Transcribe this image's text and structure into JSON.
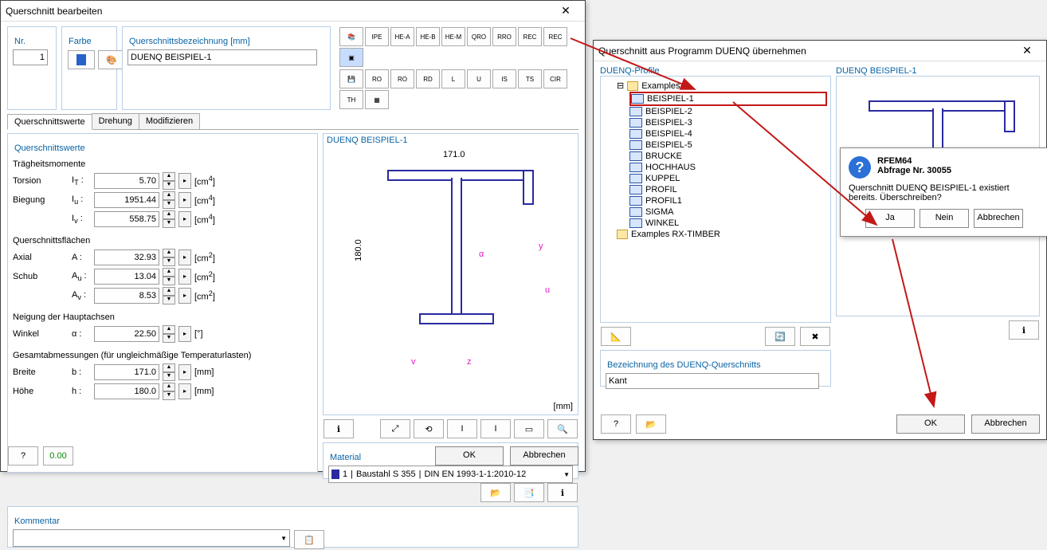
{
  "dlg1": {
    "title": "Querschnitt bearbeiten",
    "close": "✕",
    "nr": {
      "label": "Nr.",
      "value": "1"
    },
    "farbe": {
      "label": "Farbe"
    },
    "desig": {
      "label": "Querschnittsbezeichnung [mm]",
      "value": "DUENQ BEISPIEL-1"
    },
    "tabs": [
      "Querschnittswerte",
      "Drehung",
      "Modifizieren"
    ],
    "qsw": {
      "title": "Querschnittswerte",
      "traeg": "Trägheitsmomente",
      "rows1": [
        {
          "lab": "Torsion",
          "sym": "I<sub>T</sub> :",
          "val": "5.70",
          "unit": "[cm<sup>4</sup>]"
        },
        {
          "lab": "Biegung",
          "sym": "I<sub>u</sub> :",
          "val": "1951.44",
          "unit": "[cm<sup>4</sup>]"
        },
        {
          "lab": "",
          "sym": "I<sub>v</sub> :",
          "val": "558.75",
          "unit": "[cm<sup>4</sup>]"
        }
      ],
      "qf": "Querschnittsflächen",
      "rows2": [
        {
          "lab": "Axial",
          "sym": "A :",
          "val": "32.93",
          "unit": "[cm<sup>2</sup>]"
        },
        {
          "lab": "Schub",
          "sym": "A<sub>u</sub> :",
          "val": "13.04",
          "unit": "[cm<sup>2</sup>]"
        },
        {
          "lab": "",
          "sym": "A<sub>v</sub> :",
          "val": "8.53",
          "unit": "[cm<sup>2</sup>]"
        }
      ],
      "neig": "Neigung der Hauptachsen",
      "winkel": {
        "lab": "Winkel",
        "sym": "α :",
        "val": "22.50",
        "unit": "[°]"
      },
      "ges": "Gesamtabmessungen (für ungleichmäßige Temperaturlasten)",
      "breite": {
        "lab": "Breite",
        "sym": "b :",
        "val": "171.0",
        "unit": "[mm]"
      },
      "hoehe": {
        "lab": "Höhe",
        "sym": "h :",
        "val": "180.0",
        "unit": "[mm]"
      }
    },
    "kommentar": {
      "label": "Kommentar",
      "value": ""
    },
    "preview": {
      "title": "DUENQ BEISPIEL-1",
      "w": "171.0",
      "h": "180.0",
      "mm": "[mm]",
      "axes": {
        "y": "y",
        "u": "u",
        "z": "z",
        "v": "v",
        "a": "α"
      }
    },
    "material": {
      "label": "Material",
      "idx": "1",
      "name": "Baustahl S 355",
      "code": "DIN EN 1993-1-1:2010-12"
    },
    "ok": "OK",
    "cancel": "Abbrechen",
    "sectionButtons": [
      "IPE",
      "HE-A",
      "HE-B",
      "HE-M",
      "QRO",
      "RRO",
      "REC",
      "REC"
    ],
    "sectionButtons2": [
      "RO",
      "RO",
      "RD",
      "L",
      "U",
      "IS",
      "TS",
      "CIR",
      "TH"
    ]
  },
  "dlg2": {
    "title": "Querschnitt aus Programm DUENQ übernehmen",
    "close": "✕",
    "profLabel": "DUENQ-Profile",
    "tree": {
      "root": "Examples",
      "items": [
        "BEISPIEL-1",
        "BEISPIEL-2",
        "BEISPIEL-3",
        "BEISPIEL-4",
        "BEISPIEL-5",
        "BRUCKE",
        "HOCHHAUS",
        "KUPPEL",
        "PROFIL",
        "PROFIL1",
        "SIGMA",
        "WINKEL"
      ],
      "root2": "Examples RX-TIMBER"
    },
    "previewTitle": "DUENQ BEISPIEL-1",
    "bez": {
      "label": "Bezeichnung des DUENQ-Querschnitts",
      "value": "Kant"
    },
    "ok": "OK",
    "cancel": "Abbrechen"
  },
  "msg": {
    "app": "RFEM64",
    "num": "Abfrage Nr. 30055",
    "text": "Querschnitt DUENQ BEISPIEL-1 existiert bereits. Überschreiben?",
    "ja": "Ja",
    "nein": "Nein",
    "abbr": "Abbrechen"
  }
}
